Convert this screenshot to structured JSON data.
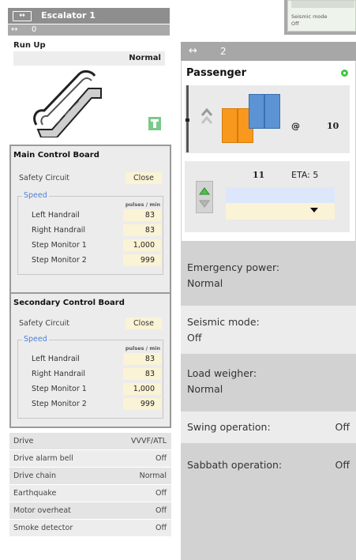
{
  "left_panel": {
    "title": "Escalator 1",
    "title_icon": "horizontal-arrows-icon",
    "sub_arrow": "↔",
    "sub_number": "0",
    "run": {
      "label": "Run Up",
      "mode": "Normal"
    },
    "main_board": {
      "title": "Main Control Board",
      "safety_label": "Safety Circuit",
      "safety_value": "Close",
      "speed_label": "Speed",
      "unit": "pulses / min",
      "rows": [
        {
          "label": "Left Handrail",
          "value": "83"
        },
        {
          "label": "Right Handrail",
          "value": "83"
        },
        {
          "label": "Step Monitor 1",
          "value": "1,000"
        },
        {
          "label": "Step Monitor 2",
          "value": "999"
        }
      ]
    },
    "secondary_board": {
      "title": "Secondary Control Board",
      "safety_label": "Safety Circuit",
      "safety_value": "Close",
      "speed_label": "Speed",
      "unit": "pulses / min",
      "rows": [
        {
          "label": "Left Handrail",
          "value": "83"
        },
        {
          "label": "Right Handrail",
          "value": "83"
        },
        {
          "label": "Step Monitor 1",
          "value": "1,000"
        },
        {
          "label": "Step Monitor 2",
          "value": "999"
        }
      ]
    },
    "status_rows": [
      {
        "label": "Drive",
        "value": "VVVF/ATL"
      },
      {
        "label": "Drive alarm bell",
        "value": "Off"
      },
      {
        "label": "Drive chain",
        "value": "Normal"
      },
      {
        "label": "Earthquake",
        "value": "Off"
      },
      {
        "label": "Motor overheat",
        "value": "Off"
      },
      {
        "label": "Smoke detector",
        "value": "Off"
      }
    ]
  },
  "peek_card": {
    "line1": "Seismic mode",
    "line2": "Off"
  },
  "right_panel": {
    "arrow": "↔",
    "number": "2",
    "card": {
      "title": "Passenger",
      "status_color": "#42c842",
      "at_symbol": "@",
      "floor": "10",
      "call_number": "11",
      "eta": "ETA: 5"
    },
    "info": [
      {
        "label": "Emergency power:",
        "value": "Normal"
      },
      {
        "label": "Seismic mode:",
        "value": "Off"
      },
      {
        "label": "Load weigher:",
        "value": "Normal"
      },
      {
        "label": "Swing operation:",
        "value": "Off"
      },
      {
        "label": "Sabbath operation:",
        "value": "Off"
      }
    ]
  }
}
